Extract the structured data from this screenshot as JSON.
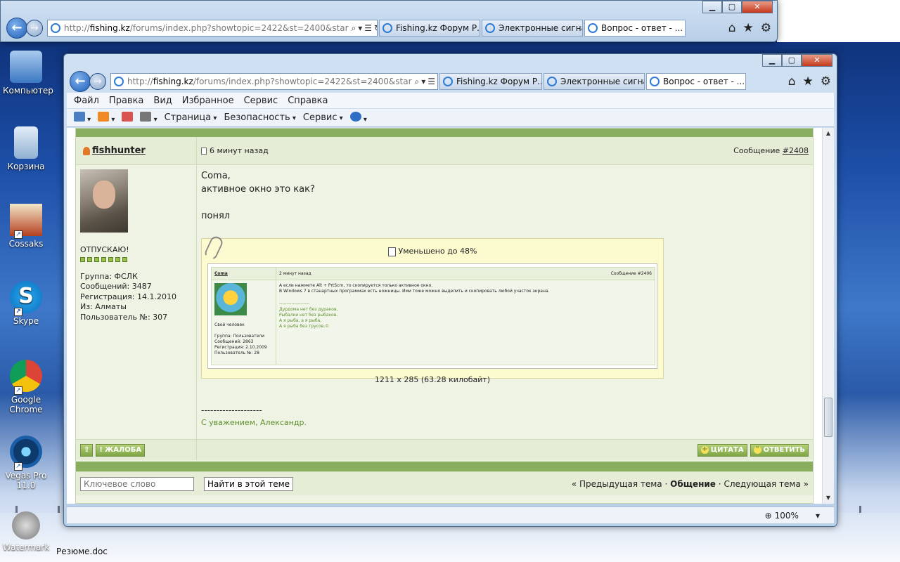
{
  "desktop": {
    "icons": [
      {
        "label": "Компьютер"
      },
      {
        "label": "Корзина"
      },
      {
        "label": "Cossaks"
      },
      {
        "label": "Skype"
      },
      {
        "label": "Google Chrome"
      },
      {
        "label": "Vegas Pro 11.0"
      },
      {
        "label": "Watermark"
      }
    ],
    "file_label": "Резюме.doc"
  },
  "browser": {
    "url_dim_prefix": "http://",
    "url_host": "fishing.kz",
    "url_rest": "/forums/index.php?showtopic=2422&st=2400&star",
    "tabs": [
      {
        "label": "Fishing.kz Форум Р..."
      },
      {
        "label": "Электронные сигна..."
      },
      {
        "label": "Вопрос - ответ - ..."
      }
    ],
    "back_tabs": [
      {
        "label": "Fishing.kz Форум Р..."
      },
      {
        "label": "Электронные сигна..."
      },
      {
        "label": "Вопрос - ответ - ..."
      }
    ],
    "menu": [
      "Файл",
      "Правка",
      "Вид",
      "Избранное",
      "Сервис",
      "Справка"
    ],
    "commands": {
      "page": "Страница",
      "security": "Безопасность",
      "tools": "Сервис"
    },
    "zoom": "100%"
  },
  "post": {
    "author": "fishhunter",
    "time": "6 минут назад",
    "msg_label": "Сообщение",
    "msg_num": "#2408",
    "status": "ОТПУСКАЮ!",
    "group": "Группа: ФСЛК",
    "messages": "Сообщений: 3487",
    "registered": "Регистрация: 14.1.2010",
    "from": "Из: Алматы",
    "user_no": "Пользователь №: 307",
    "lines": [
      "Coma,",
      "активное окно это как?",
      "",
      "понял"
    ],
    "attach_caption": "Уменьшено до 48%",
    "attach_dims": "1211 x 285 (63.28 килобайт)",
    "sig_dashes": "--------------------",
    "sig_text": "С уважением, Александр.",
    "btn_report": "ЖАЛОБА",
    "btn_quote": "ЦИТАТА",
    "btn_reply": "ОТВЕТИТЬ"
  },
  "mini": {
    "author": "Coma",
    "time": "2 минут назад",
    "num": "Сообщение #2406",
    "l1": "А если нажмете Alt + PrtScrn, то скопируется только активное окно.",
    "l2": "В Windows 7 в станартных программах есть ножницы. Ими тоже можно выделить и скопировать любой участок экрана.",
    "dash": "--------------------",
    "g1": "Дурдома нет без дураков,",
    "g2": "Рыбалки нет без рыбаков,",
    "g3": "А я рыба, а я рыба,",
    "g4": "А я рыба без трусов.©",
    "side1": "Свой человек",
    "side2": "Группа: Пользователи",
    "side3": "Сообщений: 2863",
    "side4": "Регистрация: 2.10.2009",
    "side5": "Пользователь №: 28"
  },
  "search": {
    "placeholder": "Ключевое слово",
    "button": "Найти в этой теме",
    "prev": "« Предыдущая тема",
    "sep": "·",
    "current": "Общение",
    "next": "Следующая тема »"
  },
  "colors": {
    "accent": "#8aae5f",
    "forum_bg": "#eef3e4",
    "attach_bg": "#fbfbcf"
  }
}
